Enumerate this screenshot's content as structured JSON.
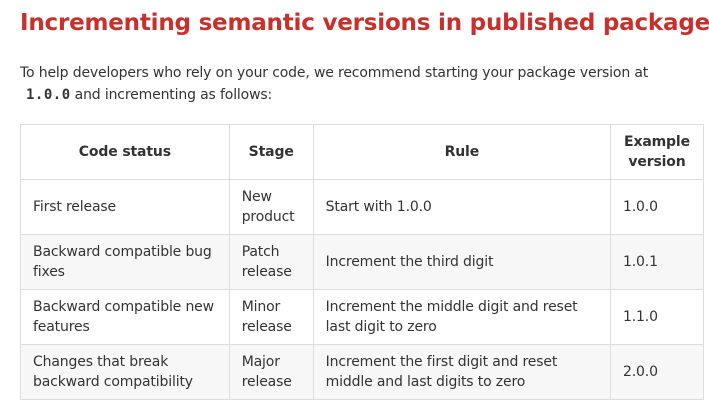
{
  "heading": "Incrementing semantic versions in published packages",
  "intro": {
    "text_before": "To help developers who rely on your code, we recommend starting your package version at",
    "code": "1.0.0",
    "text_after": "and incrementing as follows:"
  },
  "table": {
    "headers": {
      "code_status": "Code status",
      "stage": "Stage",
      "rule": "Rule",
      "example_version": "Example version"
    },
    "rows": [
      {
        "code_status": "First release",
        "stage": "New product",
        "rule": "Start with 1.0.0",
        "example_version": "1.0.0"
      },
      {
        "code_status": "Backward compatible bug fixes",
        "stage": "Patch release",
        "rule": "Increment the third digit",
        "example_version": "1.0.1"
      },
      {
        "code_status": "Backward compatible new features",
        "stage": "Minor release",
        "rule": "Increment the middle digit and reset last digit to zero",
        "example_version": "1.1.0"
      },
      {
        "code_status": "Changes that break backward compatibility",
        "stage": "Major release",
        "rule": "Increment the first digit and reset middle and last digits to zero",
        "example_version": "2.0.0"
      }
    ]
  },
  "colors": {
    "heading": "#c9302c",
    "text": "#333333",
    "border": "#dddddd",
    "row_stripe": "#f7f7f7"
  }
}
